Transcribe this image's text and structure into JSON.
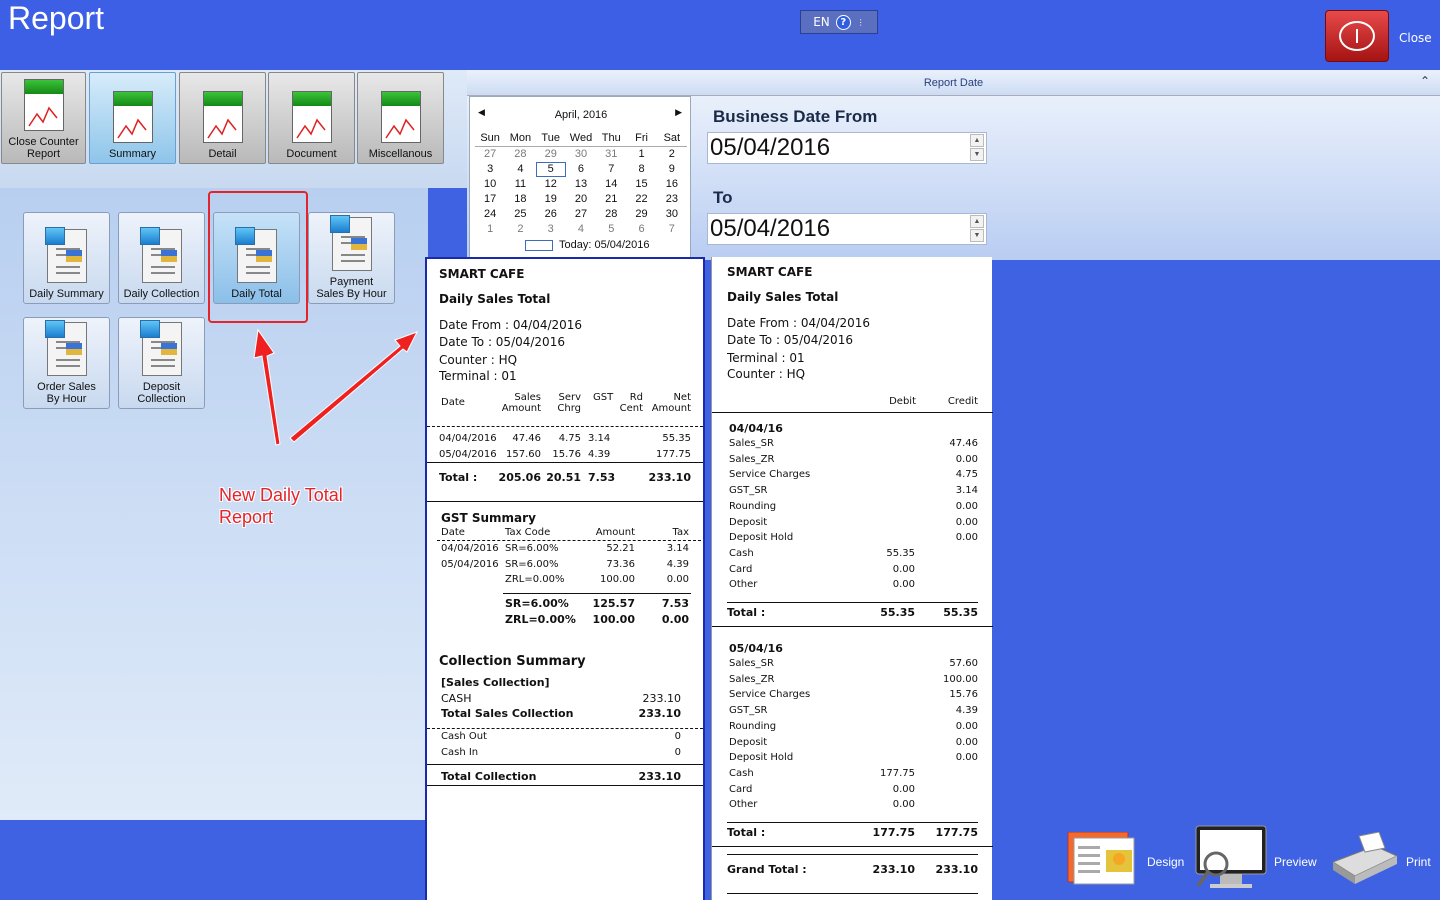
{
  "header": {
    "title": "Report",
    "lang": "EN",
    "help": "?",
    "close_label": "Close"
  },
  "toolbar": [
    "Close Counter Report",
    "Summary",
    "Detail",
    "Document",
    "Miscellanous"
  ],
  "report_date": {
    "bar_title": "Report Date",
    "calendar": {
      "month": "April, 2016",
      "weekdays": [
        "Sun",
        "Mon",
        "Tue",
        "Wed",
        "Thu",
        "Fri",
        "Sat"
      ],
      "weeks": [
        [
          "27",
          "28",
          "29",
          "30",
          "31",
          "1",
          "2"
        ],
        [
          "3",
          "4",
          "5",
          "6",
          "7",
          "8",
          "9"
        ],
        [
          "10",
          "11",
          "12",
          "13",
          "14",
          "15",
          "16"
        ],
        [
          "17",
          "18",
          "19",
          "20",
          "21",
          "22",
          "23"
        ],
        [
          "24",
          "25",
          "26",
          "27",
          "28",
          "29",
          "30"
        ],
        [
          "1",
          "2",
          "3",
          "4",
          "5",
          "6",
          "7"
        ]
      ],
      "today": "Today: 05/04/2016"
    },
    "from_label": "Business Date From",
    "from_value": "05/04/2016",
    "to_label": "To",
    "to_value": "05/04/2016"
  },
  "reports": [
    "Daily Summary",
    "Daily Collection",
    "Daily Total",
    "Payment Sales By Hour",
    "Order Sales By Hour",
    "Deposit Collection"
  ],
  "annotation": "New Daily Total Report",
  "receipt1": {
    "shop": "SMART CAFE",
    "title": "Daily Sales Total",
    "date_from": "Date From :  04/04/2016",
    "date_to": "Date To :     05/04/2016",
    "counter": "Counter  : HQ",
    "terminal": "Terminal : 01",
    "cols": {
      "date": "Date",
      "sales1": "Sales",
      "sales2": "Amount",
      "serv1": "Serv",
      "serv2": "Chrg",
      "gst": "GST",
      "rd1": "Rd",
      "rd2": "Cent",
      "net1": "Net",
      "net2": "Amount"
    },
    "rows": [
      [
        "04/04/2016",
        "47.46",
        "4.75",
        "3.14",
        "55.35"
      ],
      [
        "05/04/2016",
        "157.60",
        "15.76",
        "4.39",
        "177.75"
      ]
    ],
    "total": {
      "label": "Total :",
      "sales": "205.06",
      "serv": "20.51",
      "gst": "7.53",
      "net": "233.10"
    },
    "gst_summary": {
      "title": "GST Summary",
      "cols": [
        "Date",
        "Tax Code",
        "Amount",
        "Tax"
      ],
      "rows": [
        [
          "04/04/2016",
          "SR=6.00%",
          "52.21",
          "3.14"
        ],
        [
          "05/04/2016",
          "SR=6.00%",
          "73.36",
          "4.39"
        ],
        [
          "",
          "ZRL=0.00%",
          "100.00",
          "0.00"
        ]
      ],
      "totals": [
        [
          "SR=6.00%",
          "125.57",
          "7.53"
        ],
        [
          "ZRL=0.00%",
          "100.00",
          "0.00"
        ]
      ]
    },
    "collection": {
      "title": "Collection Summary",
      "section": "[Sales Collection]",
      "cash_label": "CASH",
      "cash": "233.10",
      "total_sales_label": "Total Sales Collection",
      "total_sales": "233.10",
      "cash_out_label": "Cash Out",
      "cash_out": "0",
      "cash_in_label": "Cash In",
      "cash_in": "0",
      "total_label": "Total Collection",
      "total": "233.10"
    }
  },
  "receipt2": {
    "shop": "SMART CAFE",
    "title": "Daily Sales Total",
    "date_from": "Date From :  04/04/2016",
    "date_to": "Date To :     05/04/2016",
    "terminal": "Terminal : 01",
    "counter": "Counter  : HQ",
    "debit": "Debit",
    "credit": "Credit",
    "days": [
      {
        "date": "04/04/16",
        "lines": [
          [
            "Sales_SR",
            "",
            "47.46"
          ],
          [
            "Sales_ZR",
            "",
            "0.00"
          ],
          [
            "Service Charges",
            "",
            "4.75"
          ],
          [
            "GST_SR",
            "",
            "3.14"
          ],
          [
            "Rounding",
            "",
            "0.00"
          ],
          [
            "Deposit",
            "",
            "0.00"
          ],
          [
            "Deposit Hold",
            "",
            "0.00"
          ],
          [
            "Cash",
            "55.35",
            ""
          ],
          [
            "Card",
            "0.00",
            ""
          ],
          [
            "Other",
            "0.00",
            ""
          ]
        ],
        "total": [
          "Total :",
          "55.35",
          "55.35"
        ]
      },
      {
        "date": "05/04/16",
        "lines": [
          [
            "Sales_SR",
            "",
            "57.60"
          ],
          [
            "Sales_ZR",
            "",
            "100.00"
          ],
          [
            "Service Charges",
            "",
            "15.76"
          ],
          [
            "GST_SR",
            "",
            "4.39"
          ],
          [
            "Rounding",
            "",
            "0.00"
          ],
          [
            "Deposit",
            "",
            "0.00"
          ],
          [
            "Deposit Hold",
            "",
            "0.00"
          ],
          [
            "Cash",
            "177.75",
            ""
          ],
          [
            "Card",
            "0.00",
            ""
          ],
          [
            "Other",
            "0.00",
            ""
          ]
        ],
        "total": [
          "Total :",
          "177.75",
          "177.75"
        ]
      }
    ],
    "grand": [
      "Grand Total :",
      "233.10",
      "233.10"
    ]
  },
  "bottom": {
    "design": "Design",
    "preview": "Preview",
    "print": "Print"
  }
}
